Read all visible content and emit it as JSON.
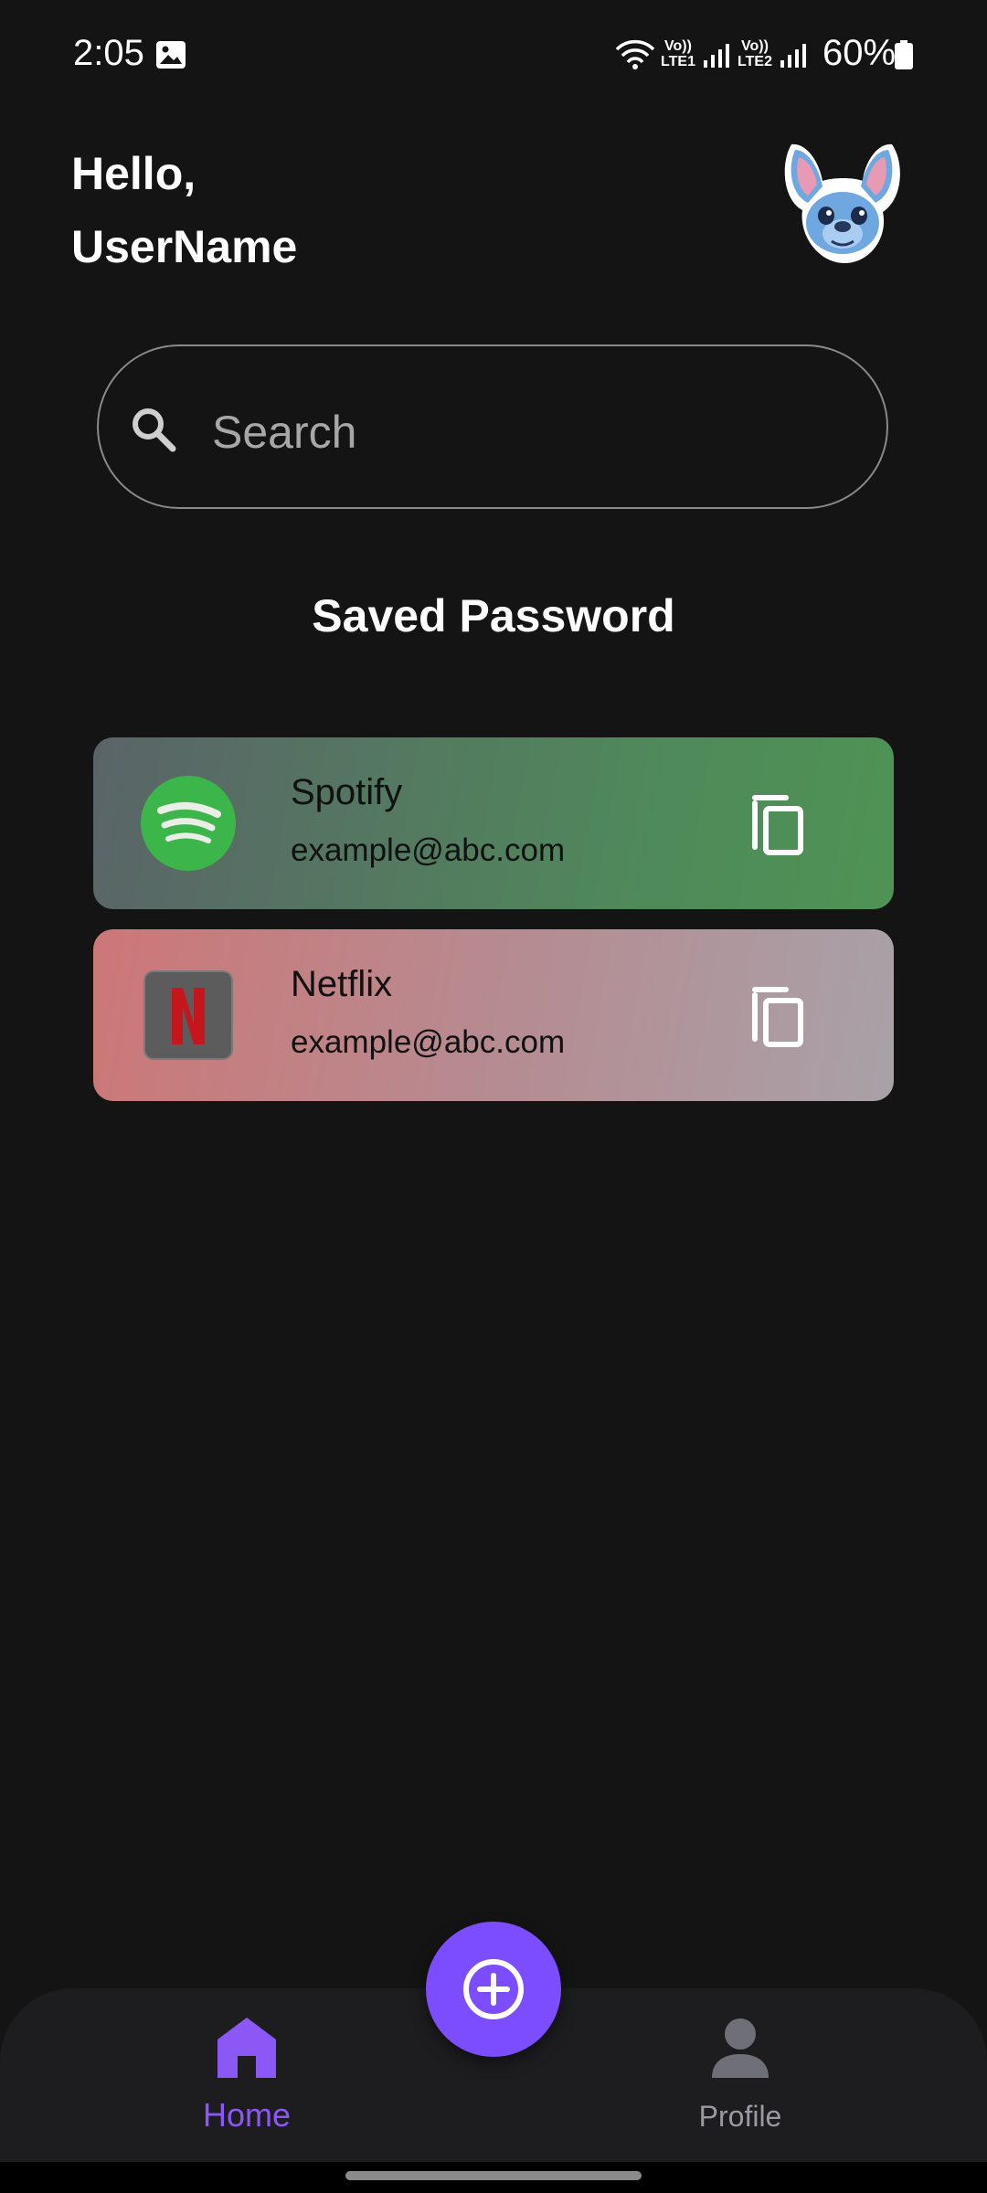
{
  "status_bar": {
    "time": "2:05",
    "lte1": "Vo))\nLTE1",
    "lte2": "Vo))\nLTE2",
    "battery": "60%",
    "icons": [
      "gallery-icon",
      "wifi-icon",
      "signal-icon",
      "battery-icon"
    ]
  },
  "header": {
    "greeting_line1": "Hello,",
    "greeting_line2": "UserName",
    "avatar_icon": "avatar-stitch"
  },
  "search": {
    "placeholder": "Search",
    "value": ""
  },
  "section": {
    "title": "Saved Password"
  },
  "passwords": [
    {
      "name": "Spotify",
      "email": "example@abc.com",
      "logo": "spotify-logo",
      "accent": "#4f9354"
    },
    {
      "name": "Netflix",
      "email": "example@abc.com",
      "logo": "netflix-logo",
      "accent": "#cd7777"
    }
  ],
  "bottom_nav": {
    "home_label": "Home",
    "profile_label": "Profile",
    "active": "Home",
    "active_color": "#8b58f5",
    "fab_icon": "add-circle-icon"
  }
}
